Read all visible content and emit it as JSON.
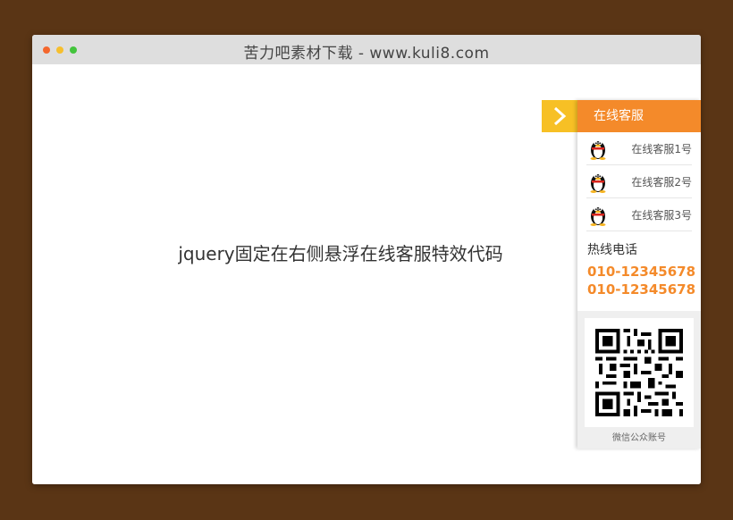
{
  "window": {
    "title": "苦力吧素材下载 - www.kuli8.com"
  },
  "main": {
    "heading": "jquery固定在右侧悬浮在线客服特效代码"
  },
  "service_panel": {
    "header": "在线客服",
    "toggle_icon": "chevron-right-icon",
    "agents": [
      {
        "label": "在线客服1号",
        "icon": "qq-penguin-icon"
      },
      {
        "label": "在线客服2号",
        "icon": "qq-penguin-icon"
      },
      {
        "label": "在线客服3号",
        "icon": "qq-penguin-icon"
      }
    ],
    "hotline_title": "热线电话",
    "hotline_numbers": [
      "010-12345678",
      "010-12345678"
    ],
    "qr_caption": "微信公众账号"
  },
  "colors": {
    "background": "#5a3515",
    "accent_orange": "#f48a2a",
    "toggle_yellow": "#f7c025"
  }
}
